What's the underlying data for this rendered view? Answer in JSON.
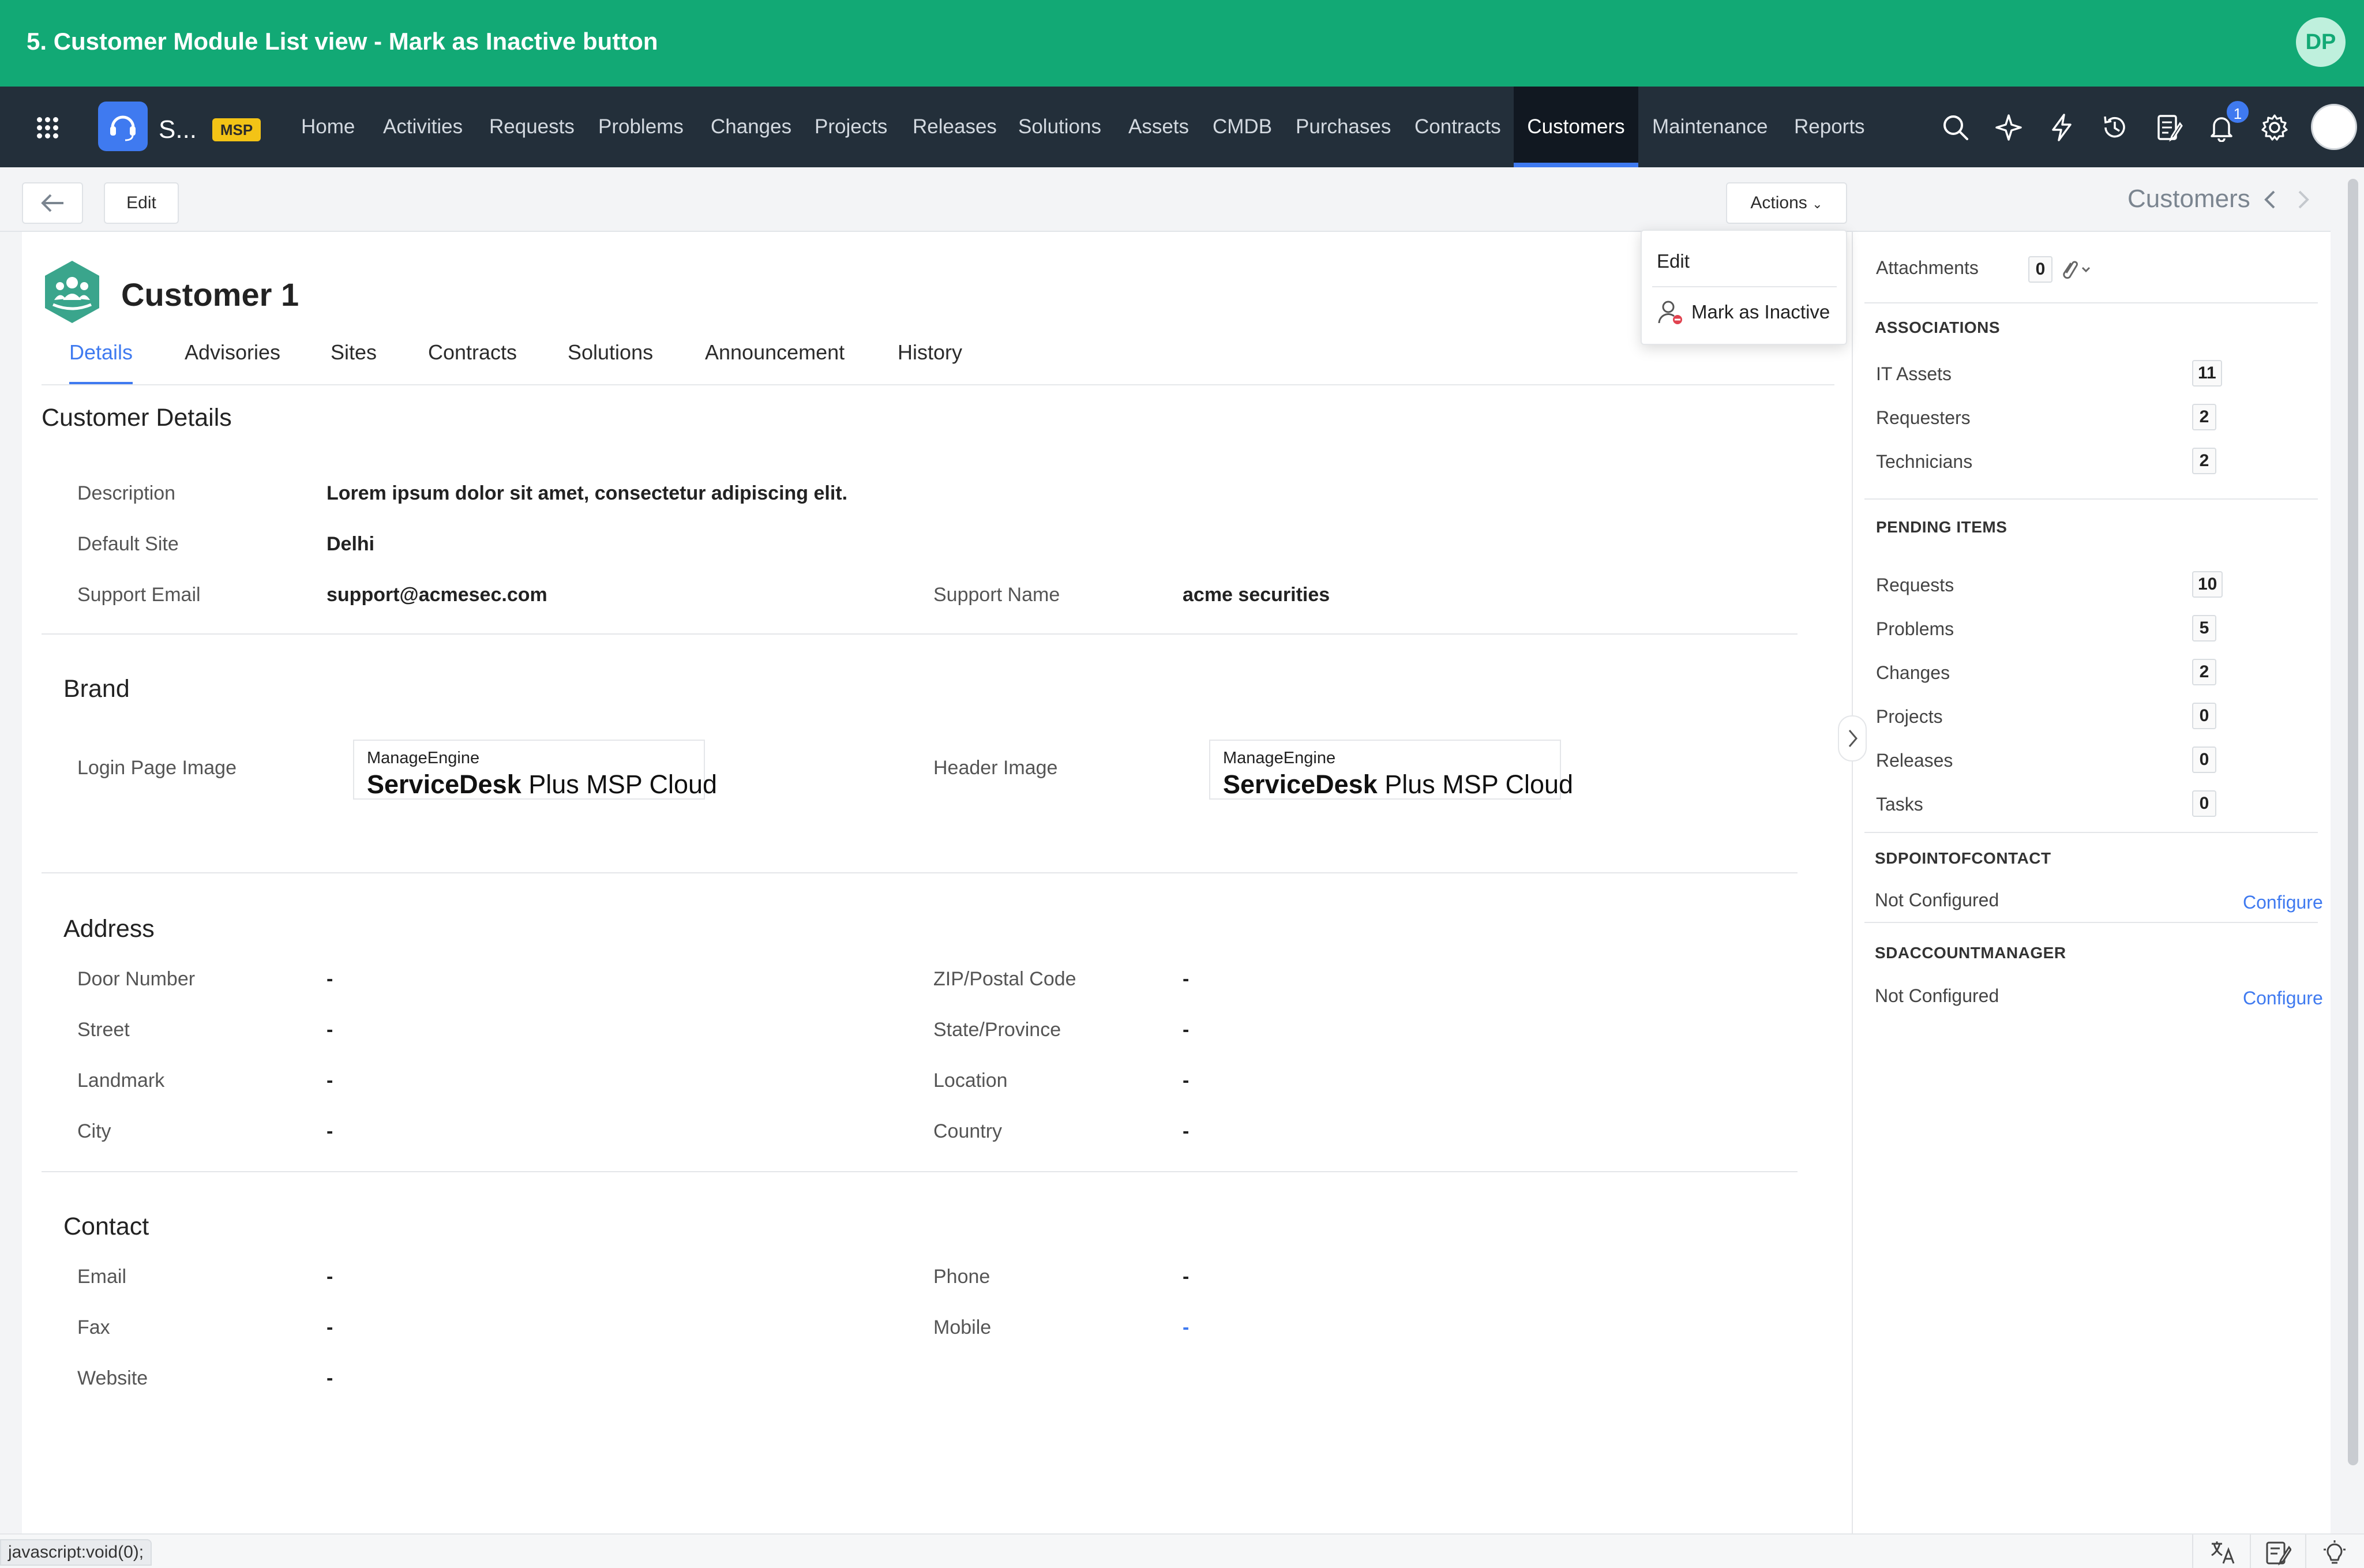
{
  "banner": {
    "title": "5. Customer Module List view - Mark as Inactive button",
    "avatar": "DP"
  },
  "app": {
    "name": "S...",
    "badge": "MSP"
  },
  "nav": [
    {
      "label": "Home"
    },
    {
      "label": "Activities"
    },
    {
      "label": "Requests"
    },
    {
      "label": "Problems"
    },
    {
      "label": "Changes"
    },
    {
      "label": "Projects"
    },
    {
      "label": "Releases"
    },
    {
      "label": "Solutions"
    },
    {
      "label": "Assets"
    },
    {
      "label": "CMDB"
    },
    {
      "label": "Purchases"
    },
    {
      "label": "Contracts"
    },
    {
      "label": "Customers",
      "active": true
    },
    {
      "label": "Maintenance"
    },
    {
      "label": "Reports"
    }
  ],
  "nav_icons": [
    "search-icon",
    "sparkle-icon",
    "lightning-icon",
    "history-icon",
    "notes-icon",
    "bell-icon",
    "gear-icon",
    "user-avatar"
  ],
  "notifications_count": "1",
  "toolbar": {
    "edit_label": "Edit",
    "actions_label": "Actions",
    "module_title": "Customers"
  },
  "dropdown": {
    "edit_label": "Edit",
    "inactive_label": "Mark as Inactive"
  },
  "customer": {
    "name": "Customer 1"
  },
  "tabs": [
    "Details",
    "Advisories",
    "Sites",
    "Contracts",
    "Solutions",
    "Announcement",
    "History"
  ],
  "details": {
    "section_title": "Customer Details",
    "description_label": "Description",
    "description_value": "Lorem ipsum dolor sit amet, consectetur adipiscing elit.",
    "default_site_label": "Default Site",
    "default_site_value": "Delhi",
    "support_email_label": "Support Email",
    "support_email_value": "support@acmesec.com",
    "support_name_label": "Support Name",
    "support_name_value": "acme securities"
  },
  "brand": {
    "section_title": "Brand",
    "login_label": "Login Page Image",
    "header_label": "Header Image",
    "logo_company": "ManageEngine",
    "logo_product_bold": "ServiceDesk",
    "logo_product_rest": " Plus MSP Cloud"
  },
  "address": {
    "section_title": "Address",
    "door_label": "Door Number",
    "door_value": "-",
    "zip_label": "ZIP/Postal Code",
    "zip_value": "-",
    "street_label": "Street",
    "street_value": "-",
    "state_label": "State/Province",
    "state_value": "-",
    "landmark_label": "Landmark",
    "landmark_value": "-",
    "location_label": "Location",
    "location_value": "-",
    "city_label": "City",
    "city_value": "-",
    "country_label": "Country",
    "country_value": "-"
  },
  "contact": {
    "section_title": "Contact",
    "email_label": "Email",
    "email_value": "-",
    "phone_label": "Phone",
    "phone_value": "-",
    "fax_label": "Fax",
    "fax_value": "-",
    "mobile_label": "Mobile",
    "mobile_value": "-",
    "website_label": "Website",
    "website_value": "-"
  },
  "right_panel": {
    "attachments_label": "Attachments",
    "attachments_count": "0",
    "associations_head": "ASSOCIATIONS",
    "associations": [
      {
        "label": "IT Assets",
        "count": "11"
      },
      {
        "label": "Requesters",
        "count": "2"
      },
      {
        "label": "Technicians",
        "count": "2"
      }
    ],
    "pending_head": "PENDING ITEMS",
    "pending": [
      {
        "label": "Requests",
        "count": "10"
      },
      {
        "label": "Problems",
        "count": "5"
      },
      {
        "label": "Changes",
        "count": "2"
      },
      {
        "label": "Projects",
        "count": "0"
      },
      {
        "label": "Releases",
        "count": "0"
      },
      {
        "label": "Tasks",
        "count": "0"
      }
    ],
    "poc_head": "SDPOINTOFCONTACT",
    "poc_value": "Not Configured",
    "poc_link": "Configure",
    "am_head": "SDACCOUNTMANAGER",
    "am_value": "Not Configured",
    "am_link": "Configure"
  },
  "statusbar": {
    "text": "javascript:void(0);"
  },
  "colors": {
    "banner": "#12a975",
    "navbar": "#232f3a",
    "accent": "#3f7af0",
    "badge": "#f3c316"
  }
}
